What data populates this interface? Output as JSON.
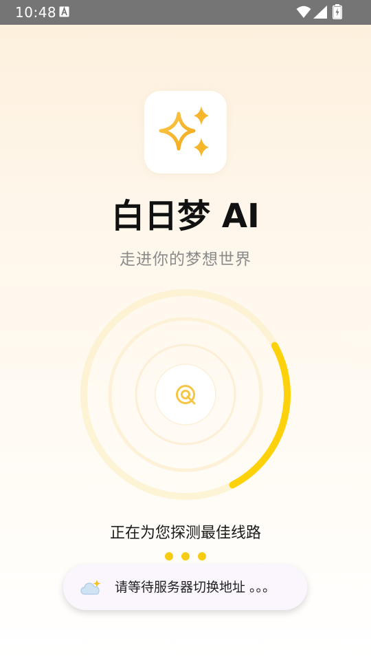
{
  "status_bar": {
    "time": "10:48",
    "icons": [
      "a-notification-icon",
      "wifi-icon",
      "signal-icon",
      "battery-charging-icon"
    ]
  },
  "app": {
    "logo_icon": "sparkles-icon",
    "title": "白日梦 AI",
    "subtitle": "走进你的梦想世界"
  },
  "loader": {
    "center_icon": "target-icon",
    "progress_arc_color": "#fdd20a"
  },
  "status": {
    "message": "正在为您探测最佳线路",
    "dot_count": 3
  },
  "toast": {
    "icon": "cloud-sun-icon",
    "text": "请等待服务器切换地址 。。。"
  },
  "colors": {
    "accent": "#fdd20a",
    "sparkle": "#f6b62c",
    "status_bar": "#757575"
  }
}
